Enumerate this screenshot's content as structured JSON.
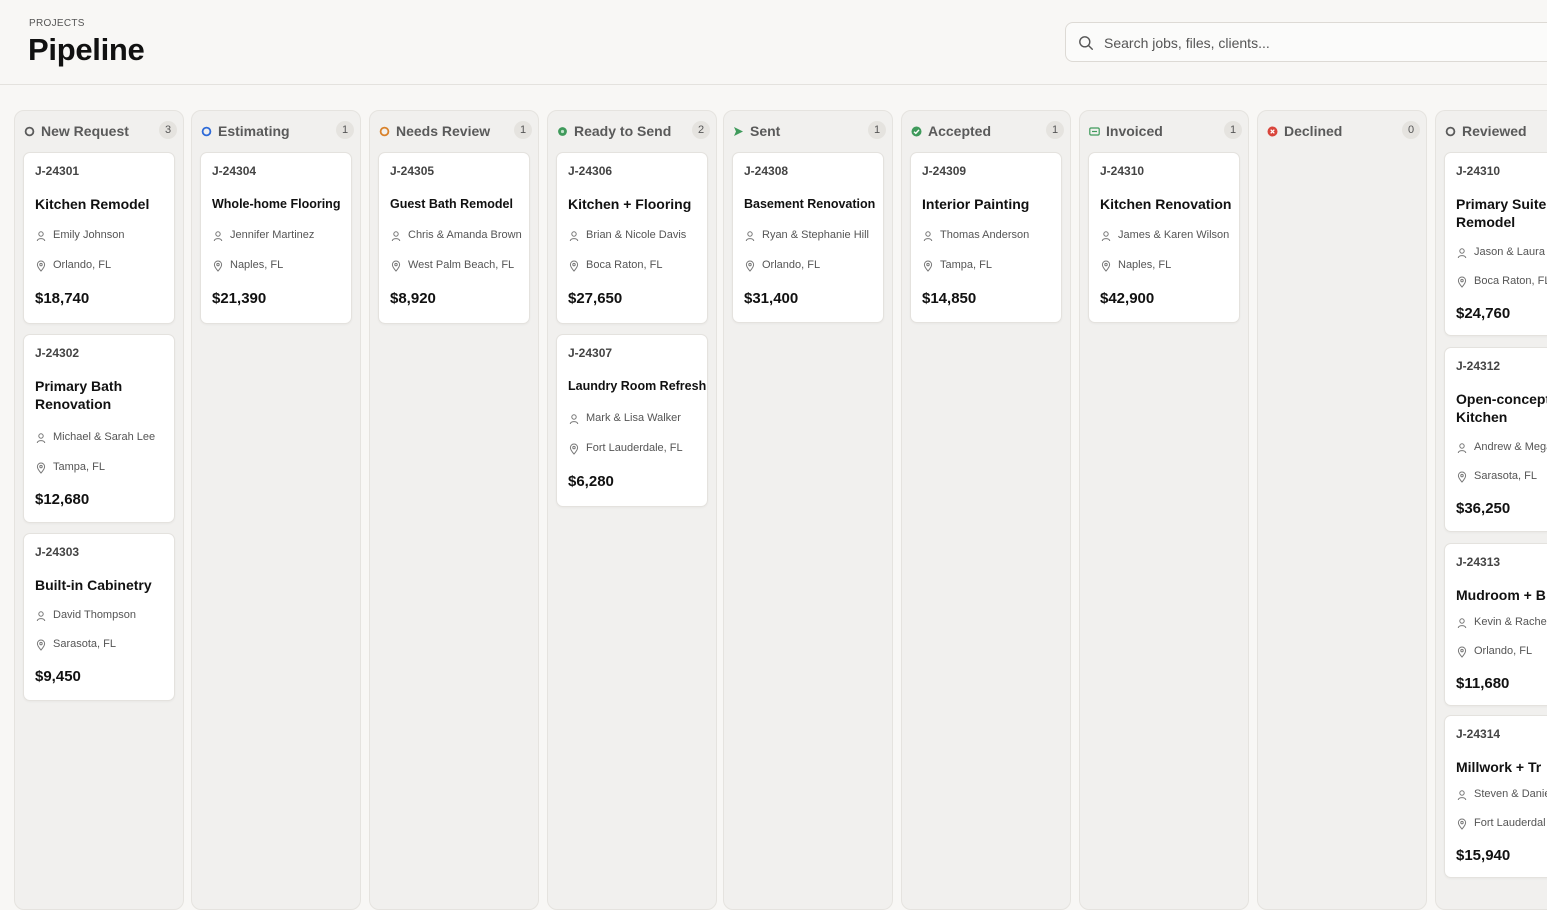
{
  "header": {
    "eyebrow": "PROJECTS",
    "title": "Pipeline",
    "search_placeholder": "Search jobs, files, clients..."
  },
  "colors": {
    "new_request": "#5c5c5c",
    "estimating": "#2f6bd8",
    "needs_review": "#d9822b",
    "ready_to_send": "#3f9a5b",
    "sent": "#3f9a5b",
    "accepted": "#3f9a5b",
    "invoiced": "#3f9a5b",
    "declined": "#d9453b",
    "reviewed": "#5c5c5c"
  },
  "columns": [
    {
      "title": "New Request",
      "count": "3",
      "icon": "circle-outline-icon",
      "cards": [
        {
          "id": "J-24301",
          "title": "Kitchen Remodel",
          "client": "Emily Johnson",
          "location": "Orlando, FL",
          "amount": "$18,740"
        },
        {
          "id": "J-24302",
          "title": "Primary Bath Renovation",
          "client": "Michael & Sarah Lee",
          "location": "Tampa, FL",
          "amount": "$12,680"
        },
        {
          "id": "J-24303",
          "title": "Built-in Cabinetry",
          "client": "David Thompson",
          "location": "Sarasota, FL",
          "amount": "$9,450"
        }
      ]
    },
    {
      "title": "Estimating",
      "count": "1",
      "icon": "circle-outline-icon",
      "cards": [
        {
          "id": "J-24304",
          "title": "Whole-home Flooring",
          "client": "Jennifer Martinez",
          "location": "Naples, FL",
          "amount": "$21,390"
        }
      ]
    },
    {
      "title": "Needs Review",
      "count": "1",
      "icon": "circle-outline-icon",
      "cards": [
        {
          "id": "J-24305",
          "title": "Guest Bath Remodel",
          "client": "Chris & Amanda Brown",
          "location": "West Palm Beach, FL",
          "amount": "$8,920"
        }
      ]
    },
    {
      "title": "Ready to Send",
      "count": "2",
      "icon": "circle-filled-icon",
      "cards": [
        {
          "id": "J-24306",
          "title": "Kitchen + Flooring",
          "client": "Brian & Nicole Davis",
          "location": "Boca Raton, FL",
          "amount": "$27,650"
        },
        {
          "id": "J-24307",
          "title": "Laundry Room Refresh",
          "client": "Mark & Lisa Walker",
          "location": "Fort Lauderdale, FL",
          "amount": "$6,280"
        }
      ]
    },
    {
      "title": "Sent",
      "count": "1",
      "icon": "send-icon",
      "cards": [
        {
          "id": "J-24308",
          "title": "Basement Renovation",
          "client": "Ryan & Stephanie Hill",
          "location": "Orlando, FL",
          "amount": "$31,400"
        }
      ]
    },
    {
      "title": "Accepted",
      "count": "1",
      "icon": "check-circle-icon",
      "cards": [
        {
          "id": "J-24309",
          "title": "Interior Painting",
          "client": "Thomas Anderson",
          "location": "Tampa, FL",
          "amount": "$14,850"
        }
      ]
    },
    {
      "title": "Invoiced",
      "count": "1",
      "icon": "invoice-icon",
      "cards": [
        {
          "id": "J-24310",
          "title": "Kitchen Renovation",
          "client": "James & Karen Wilson",
          "location": "Naples, FL",
          "amount": "$42,900"
        }
      ]
    },
    {
      "title": "Declined",
      "count": "0",
      "icon": "x-circle-icon",
      "cards": []
    },
    {
      "title": "Reviewed",
      "count": "",
      "icon": "circle-outline-icon",
      "cards": [
        {
          "id": "J-24310",
          "title": "Primary Suite Remodel",
          "client": "Jason & Laura",
          "location": "Boca Raton, FL",
          "amount": "$24,760"
        },
        {
          "id": "J-24312",
          "title": "Open-concept Kitchen",
          "client": "Andrew & Mega",
          "location": "Sarasota, FL",
          "amount": "$36,250"
        },
        {
          "id": "J-24313",
          "title": "Mudroom + B",
          "client": "Kevin & Rachel",
          "location": "Orlando, FL",
          "amount": "$11,680"
        },
        {
          "id": "J-24314",
          "title": "Millwork + Tr",
          "client": "Steven & Danie",
          "location": "Fort Lauderdal",
          "amount": "$15,940"
        }
      ]
    }
  ]
}
